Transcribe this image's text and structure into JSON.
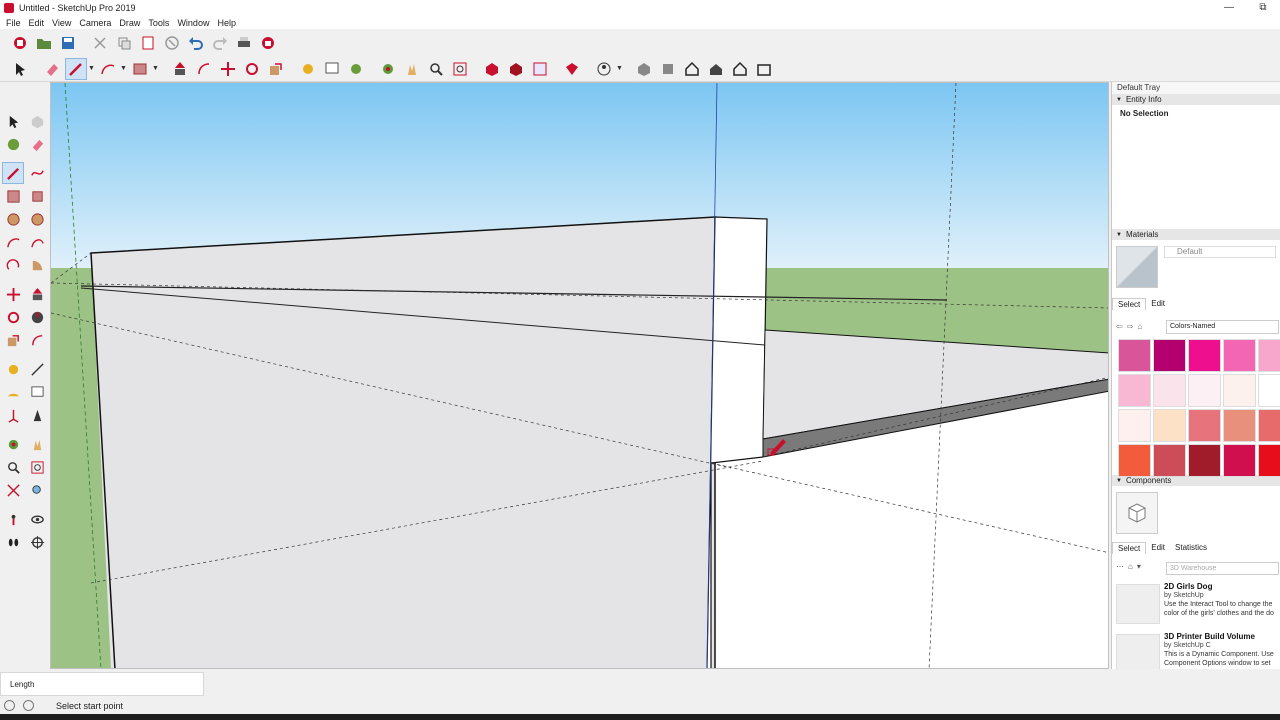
{
  "window": {
    "title": "Untitled - SketchUp Pro 2019",
    "minimize": "—",
    "restore": "⧉"
  },
  "menu": [
    "File",
    "Edit",
    "View",
    "Camera",
    "Draw",
    "Tools",
    "Window",
    "Help"
  ],
  "tray": {
    "title": "Default Tray",
    "entity_info": {
      "header": "Entity Info",
      "selection": "No Selection"
    },
    "materials": {
      "header": "Materials",
      "current": "Default",
      "tabs": [
        "Select",
        "Edit"
      ],
      "library": "Colors-Named",
      "swatches": [
        "#d9559a",
        "#b4006f",
        "#ee0f8f",
        "#f266b4",
        "#f7a7cc",
        "#f8b8d3",
        "#fbe3ec",
        "#fdf0f5",
        "#fdf1ed",
        "#ffffff",
        "#fdf0ee",
        "#fde1c7",
        "#e7737c",
        "#e8907c",
        "#e86b6b",
        "#f25c3c",
        "#cc4c58",
        "#a01c2a",
        "#d00f4e",
        "#e80d1a"
      ]
    },
    "components": {
      "header": "Components",
      "tabs": [
        "Select",
        "Edit",
        "Statistics"
      ],
      "search_placeholder": "3D Warehouse",
      "items": [
        {
          "name": "2D Girls Dog",
          "by": "by SketchUp",
          "desc": "Use the Interact Tool to change the color of the girls' clothes and the do"
        },
        {
          "name": "3D Printer Build Volume",
          "by": "by SketchUp C",
          "desc": "This is a Dynamic Component. Use Component Options window to set"
        }
      ]
    }
  },
  "measurements": {
    "label": "Length"
  },
  "status": {
    "text": "Select start point"
  }
}
